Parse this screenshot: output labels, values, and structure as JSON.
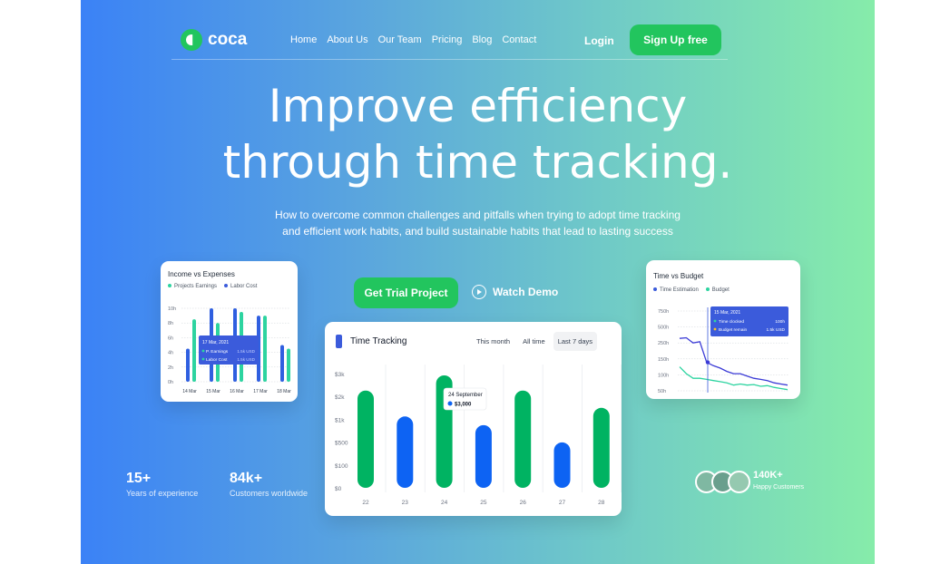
{
  "brand": {
    "name": "coca"
  },
  "nav": {
    "links": [
      "Home",
      "About Us",
      "Our Team",
      "Pricing",
      "Blog",
      "Contact"
    ],
    "login_label": "Login",
    "signup_label": "Sign Up free"
  },
  "hero": {
    "headline_line1": "Improve efficiency",
    "headline_line2": "through time tracking.",
    "subtitle_line1": "How to overcome common challenges and pitfalls when trying to adopt time tracking",
    "subtitle_line2": "and efficient work habits, and build sustainable habits that lead to lasting success",
    "trial_label": "Get Trial Project",
    "demo_label": "Watch Demo"
  },
  "stats": [
    {
      "value": "15+",
      "label": "Years of experience"
    },
    {
      "value": "84k+",
      "label": "Customers worldwide"
    }
  ],
  "social_proof": {
    "value": "140K+",
    "label": "Happy Customers"
  },
  "colors": {
    "green": "#22c55e",
    "blue": "#2563eb",
    "bar_green": "#00b362",
    "bar_blue": "#0d63f3",
    "teal": "#2dd4a0",
    "indigo": "#3b5bdb"
  },
  "chart_data": [
    {
      "type": "bar",
      "title": "Time Tracking",
      "tabs": [
        "This month",
        "All time",
        "Last 7 days"
      ],
      "active_tab": "Last 7 days",
      "categories": [
        "22",
        "23",
        "24",
        "25",
        "26",
        "27",
        "28"
      ],
      "values": [
        2250,
        1650,
        2600,
        1450,
        2250,
        1050,
        1850
      ],
      "colors": [
        "green",
        "blue",
        "green",
        "blue",
        "green",
        "blue",
        "green"
      ],
      "yticks": [
        "$0",
        "$100",
        "$500",
        "$1k",
        "$2k",
        "$3k"
      ],
      "ylim": [
        0,
        2600
      ],
      "tooltip": {
        "date": "24 September",
        "value": "$3,000"
      }
    },
    {
      "type": "bar",
      "title": "Income vs Expenses",
      "legend": [
        "Projects Earnings",
        "Labor Cost"
      ],
      "categories": [
        "14 Mar",
        "15 Mar",
        "16 Mar",
        "17 Mar",
        "18 Mar"
      ],
      "series": [
        {
          "name": "Labor Cost",
          "values": [
            4.5,
            10,
            10,
            9,
            5
          ]
        },
        {
          "name": "Projects Earnings",
          "values": [
            8.5,
            8,
            9.5,
            9,
            4.5
          ]
        }
      ],
      "yticks": [
        "0h",
        "2h",
        "4h",
        "6h",
        "8h",
        "10h"
      ],
      "ylim": [
        0,
        10
      ],
      "tooltip": {
        "date": "17 Mar, 2021",
        "rows": [
          {
            "label": "P. Earnings",
            "value": "1.5k USD"
          },
          {
            "label": "Labor Cost",
            "value": "1.5k USD"
          }
        ]
      }
    },
    {
      "type": "line",
      "title": "Time vs Budget",
      "legend": [
        "Time Estimation",
        "Budget"
      ],
      "yticks": [
        "50h",
        "100h",
        "150h",
        "250h",
        "500h",
        "750h"
      ],
      "series": [
        {
          "name": "Time Estimation",
          "values": [
            510,
            515,
            470,
            480,
            300,
            270,
            250,
            220,
            200,
            200,
            180,
            160,
            150,
            140,
            120,
            110,
            100
          ]
        },
        {
          "name": "Budget",
          "values": [
            260,
            200,
            160,
            160,
            150,
            140,
            130,
            120,
            100,
            110,
            100,
            105,
            90,
            95,
            80,
            70,
            60
          ]
        }
      ],
      "tooltip": {
        "date": "15 Mar, 2021",
        "rows": [
          {
            "label": "Time clocked",
            "value": "100h"
          },
          {
            "label": "Budget remain",
            "value": "1.5k USD"
          }
        ]
      }
    }
  ]
}
